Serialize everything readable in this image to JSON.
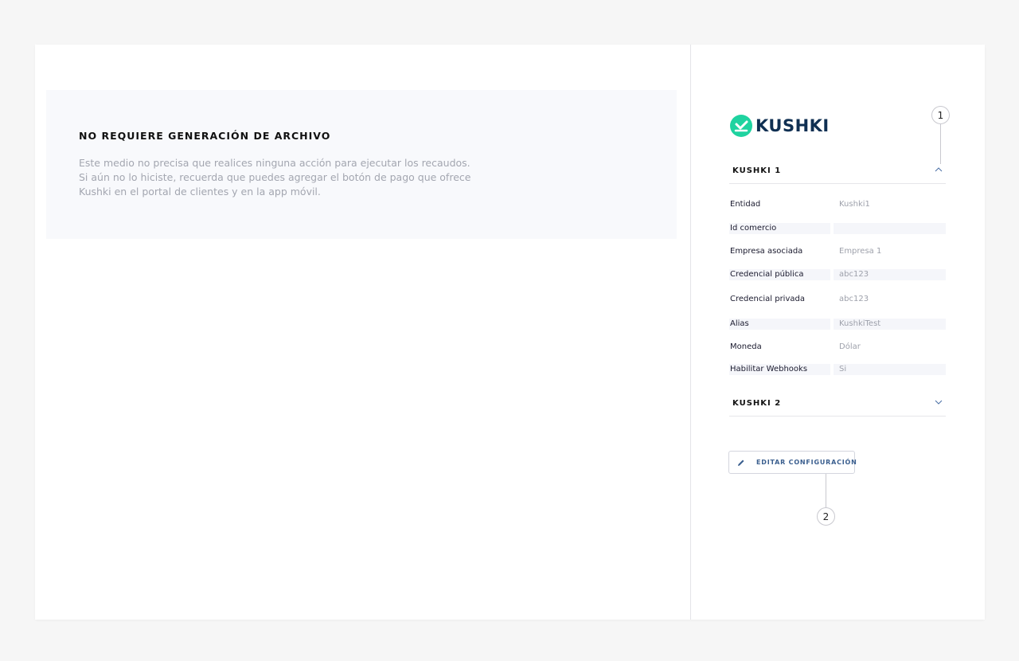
{
  "left_panel": {
    "title": "NO REQUIERE GENERACIÓN DE ARCHIVO",
    "lines": [
      "Este medio no precisa que realices ninguna acción para ejecutar los recaudos.",
      "Si aún no lo hiciste, recuerda que puedes agregar el botón de pago que ofrece",
      "Kushki en el portal de clientes y en la app móvil."
    ]
  },
  "right_panel": {
    "logo_text": "KUSHKI",
    "markers": [
      "1",
      "2"
    ],
    "sections": [
      {
        "label": "KUSHKI 1",
        "expanded": true,
        "fields": [
          {
            "label": "Entidad",
            "value": "Kushki1"
          },
          {
            "label": "Id comercio",
            "value": ""
          },
          {
            "label": "Empresa asociada",
            "value": "Empresa 1"
          },
          {
            "label": "Credencial pública",
            "value": "abc123"
          },
          {
            "label": "Credencial privada",
            "value": "abc123"
          },
          {
            "label": "Alias",
            "value": "KushkiTest"
          },
          {
            "label": "Moneda",
            "value": "Dólar"
          },
          {
            "label": "Habilitar Webhooks",
            "value": "Si"
          }
        ]
      },
      {
        "label": "KUSHKI 2",
        "expanded": false
      }
    ],
    "edit_button_label": "EDITAR CONFIGURACIÓN"
  },
  "colors": {
    "background": "#f6f6f6",
    "card": "#ffffff",
    "info_box": "#f8f9fc",
    "brand_green": "#1fd3a0",
    "brand_navy": "#0f2f52",
    "accent_blue": "#3b5f8f"
  },
  "icons": [
    "kushki-logo-icon",
    "chevron-up-icon",
    "chevron-down-icon",
    "pencil-icon"
  ]
}
